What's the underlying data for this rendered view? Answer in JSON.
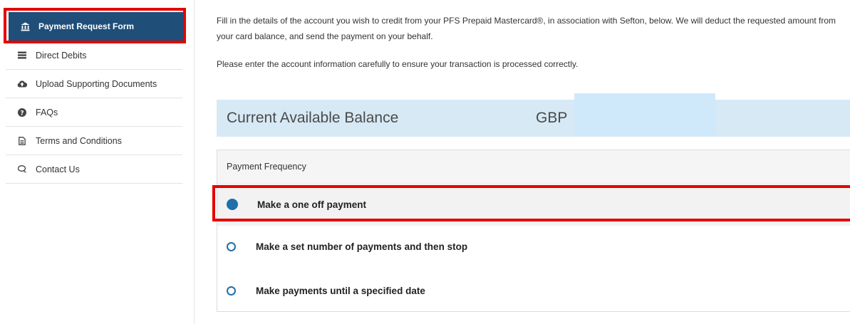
{
  "sidebar": {
    "items": [
      {
        "label": "Payment Request Form",
        "icon": "bank-icon"
      },
      {
        "label": "Direct Debits",
        "icon": "list-icon"
      },
      {
        "label": "Upload Supporting Documents",
        "icon": "cloud-upload-icon"
      },
      {
        "label": "FAQs",
        "icon": "question-circle-icon"
      },
      {
        "label": "Terms and Conditions",
        "icon": "document-icon"
      },
      {
        "label": "Contact Us",
        "icon": "chat-icon"
      }
    ],
    "active_color": "#1f4e79"
  },
  "main": {
    "intro": "Fill in the details of the account you wish to credit from your PFS Prepaid Mastercard®, in association with Sefton, below. We will deduct the requested amount from your card balance, and send the payment on your behalf.",
    "note": "Please enter the account information carefully to ensure your transaction is processed correctly.",
    "balance": {
      "label": "Current Available Balance",
      "currency": "GBP"
    },
    "frequency": {
      "header": "Payment Frequency",
      "options": [
        {
          "label": "Make a one off payment",
          "selected": true
        },
        {
          "label": "Make a set number of payments and then stop",
          "selected": false
        },
        {
          "label": "Make payments until a specified date",
          "selected": false
        }
      ]
    }
  },
  "colors": {
    "highlight": "#e60000",
    "radio": "#1f6fa8",
    "balance_bg": "#d6e9f5"
  }
}
